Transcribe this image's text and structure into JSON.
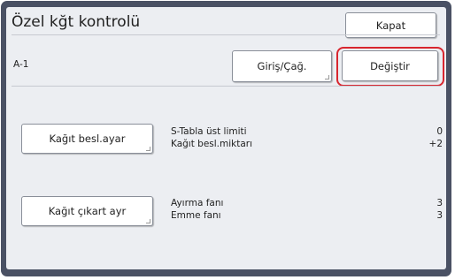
{
  "header": {
    "title": "Özel kğt kontrolü",
    "close_label": "Kapat"
  },
  "entry": {
    "name": "A-1",
    "input_label": "Giriş/Çağ.",
    "change_label": "Değiştir"
  },
  "paper_feed": {
    "button_label": "Kağıt besl.ayar",
    "rows": [
      {
        "label": "S-Tabla üst limiti",
        "value": "0"
      },
      {
        "label": "Kağıt besl.miktarı",
        "value": "+2"
      }
    ]
  },
  "paper_eject": {
    "button_label": "Kağıt çıkart ayr",
    "rows": [
      {
        "label": "Ayırma fanı",
        "value": "3"
      },
      {
        "label": "Emme fanı",
        "value": "3"
      }
    ]
  },
  "colors": {
    "frame": "#4a5164",
    "panel": "#eceef2",
    "highlight": "#d8262f"
  }
}
